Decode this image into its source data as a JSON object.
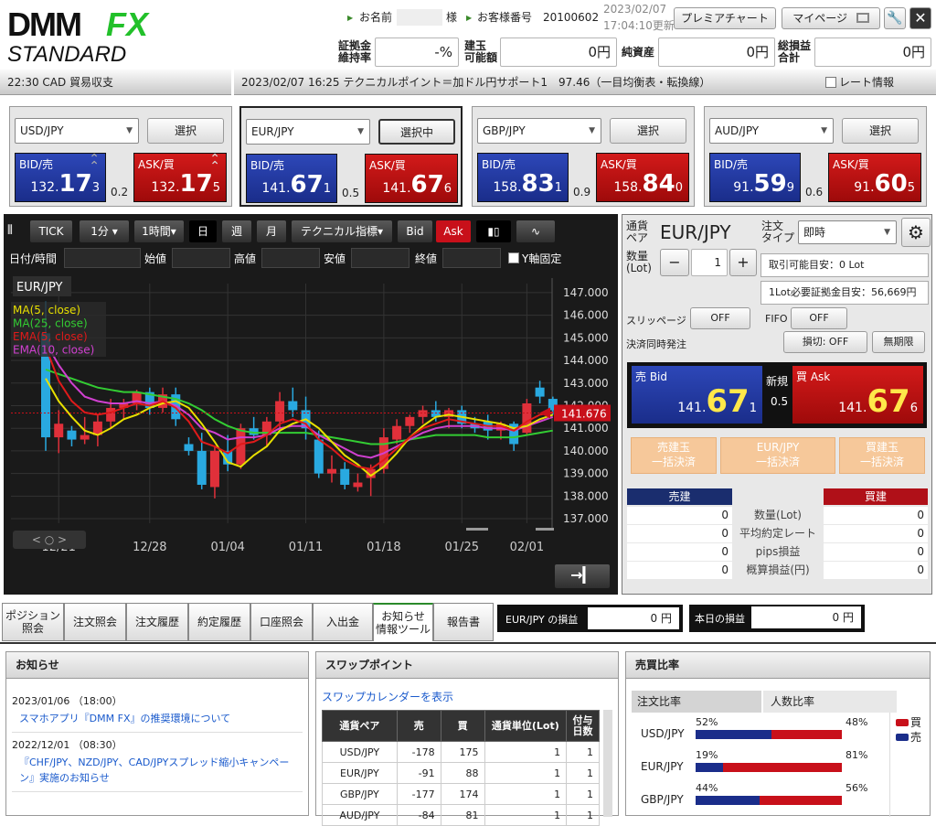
{
  "header": {
    "logo_top": "DMM",
    "logo_fx": "FX",
    "logo_bottom": "STANDARD",
    "name_label": "お名前",
    "name_suffix": "様",
    "customer_no_label": "お客様番号",
    "customer_no": "20100602",
    "date": "2023/02/07",
    "time": "17:04:10更新",
    "premier_chart": "プレミアチャート",
    "mypage": "マイページ",
    "margin_rate_label": "証拠金 維持率",
    "margin_rate": "-%",
    "open_pos_label": "建玉 可能額",
    "open_pos": "0円",
    "net_assets_label": "純資産",
    "net_assets": "0円",
    "total_pl_label": "総損益 合計",
    "total_pl": "0円"
  },
  "ticker": {
    "left": "22:30 CAD 貿易収支",
    "main": "2023/02/07 16:25 テクニカルポイント＝加ドル円サポート1　97.46（一目均衡表・転換線）",
    "rate_info": "レート情報"
  },
  "pairs": [
    {
      "pair": "USD/JPY",
      "button": "選択",
      "bid_small": "132.",
      "bid_big": "17",
      "bid_last": "3",
      "ask_small": "132.",
      "ask_big": "17",
      "ask_last": "5",
      "spread": "0.2",
      "selected": false
    },
    {
      "pair": "EUR/JPY",
      "button": "選択中",
      "bid_small": "141.",
      "bid_big": "67",
      "bid_last": "1",
      "ask_small": "141.",
      "ask_big": "67",
      "ask_last": "6",
      "spread": "0.5",
      "selected": true
    },
    {
      "pair": "GBP/JPY",
      "button": "選択",
      "bid_small": "158.",
      "bid_big": "83",
      "bid_last": "1",
      "ask_small": "158.",
      "ask_big": "84",
      "ask_last": "0",
      "spread": "0.9",
      "selected": false
    },
    {
      "pair": "AUD/JPY",
      "button": "選択",
      "bid_small": "91.",
      "bid_big": "59",
      "bid_last": "9",
      "ask_small": "91.",
      "ask_big": "60",
      "ask_last": "5",
      "spread": "0.6",
      "selected": false
    }
  ],
  "price_labels": {
    "bid": "BID/売",
    "ask": "ASK/買"
  },
  "toolbar": {
    "tick": "TICK",
    "min": "1分",
    "hour": "1時間",
    "day": "日",
    "week": "週",
    "month": "月",
    "technical": "テクニカル指標",
    "bid": "Bid",
    "ask": "Ask"
  },
  "ohlc": {
    "datetime": "日付/時間",
    "open": "始値",
    "high": "高値",
    "low": "安値",
    "close": "終値",
    "yfix": "Y軸固定"
  },
  "chart_data": {
    "type": "candlestick",
    "title": "EUR/JPY",
    "legend": [
      {
        "name": "MA(5, close)",
        "color": "#e8e000"
      },
      {
        "name": "MA(25, close)",
        "color": "#33cc33"
      },
      {
        "name": "EMA(5, close)",
        "color": "#e01a1a"
      },
      {
        "name": "EMA(10, close)",
        "color": "#d040d0"
      }
    ],
    "yticks": [
      "147.000",
      "146.000",
      "145.000",
      "144.000",
      "143.000",
      "142.000",
      "141.000",
      "140.000",
      "139.000",
      "138.000",
      "137.000"
    ],
    "ylim": [
      136.8,
      147.4
    ],
    "xticks": [
      "12/21",
      "12/28",
      "01/04",
      "01/11",
      "01/18",
      "01/25",
      "02/01"
    ],
    "current_price": "141.676",
    "current_value": 141.676,
    "candles": [
      {
        "o": 145.2,
        "h": 146.6,
        "l": 140.0,
        "c": 140.6
      },
      {
        "o": 140.6,
        "h": 141.8,
        "l": 139.9,
        "c": 141.2
      },
      {
        "o": 140.9,
        "h": 141.1,
        "l": 140.2,
        "c": 140.5
      },
      {
        "o": 140.5,
        "h": 141.5,
        "l": 140.3,
        "c": 140.7
      },
      {
        "o": 140.7,
        "h": 141.6,
        "l": 140.2,
        "c": 141.3
      },
      {
        "o": 141.3,
        "h": 142.3,
        "l": 141.0,
        "c": 141.9
      },
      {
        "o": 141.9,
        "h": 142.3,
        "l": 141.4,
        "c": 142.1
      },
      {
        "o": 142.1,
        "h": 142.7,
        "l": 141.8,
        "c": 142.6
      },
      {
        "o": 142.6,
        "h": 142.8,
        "l": 141.6,
        "c": 141.9
      },
      {
        "o": 141.9,
        "h": 142.8,
        "l": 141.7,
        "c": 142.5
      },
      {
        "o": 142.5,
        "h": 142.8,
        "l": 141.1,
        "c": 141.4
      },
      {
        "o": 140.3,
        "h": 140.6,
        "l": 139.8,
        "c": 140.0
      },
      {
        "o": 140.0,
        "h": 140.8,
        "l": 138.3,
        "c": 138.5
      },
      {
        "o": 138.4,
        "h": 140.2,
        "l": 137.9,
        "c": 140.0
      },
      {
        "o": 140.0,
        "h": 140.7,
        "l": 139.1,
        "c": 139.4
      },
      {
        "o": 139.4,
        "h": 141.2,
        "l": 139.2,
        "c": 141.0
      },
      {
        "o": 141.0,
        "h": 141.5,
        "l": 140.5,
        "c": 140.7
      },
      {
        "o": 140.7,
        "h": 141.5,
        "l": 140.2,
        "c": 141.3
      },
      {
        "o": 141.3,
        "h": 142.6,
        "l": 141.0,
        "c": 142.2
      },
      {
        "o": 142.2,
        "h": 142.8,
        "l": 141.5,
        "c": 141.8
      },
      {
        "o": 141.8,
        "h": 142.4,
        "l": 140.5,
        "c": 141.0
      },
      {
        "o": 140.5,
        "h": 140.9,
        "l": 138.8,
        "c": 139.0
      },
      {
        "o": 139.0,
        "h": 139.8,
        "l": 138.6,
        "c": 139.2
      },
      {
        "o": 139.2,
        "h": 139.5,
        "l": 138.3,
        "c": 138.5
      },
      {
        "o": 138.4,
        "h": 139.0,
        "l": 138.2,
        "c": 138.6
      },
      {
        "o": 138.8,
        "h": 139.4,
        "l": 138.0,
        "c": 139.2
      },
      {
        "o": 139.2,
        "h": 141.0,
        "l": 139.0,
        "c": 140.6
      },
      {
        "o": 140.5,
        "h": 141.4,
        "l": 140.3,
        "c": 141.1
      },
      {
        "o": 141.1,
        "h": 141.6,
        "l": 140.8,
        "c": 141.5
      },
      {
        "o": 141.5,
        "h": 142.0,
        "l": 141.2,
        "c": 141.8
      },
      {
        "o": 141.8,
        "h": 142.2,
        "l": 141.3,
        "c": 141.5
      },
      {
        "o": 141.5,
        "h": 141.9,
        "l": 141.0,
        "c": 141.8
      },
      {
        "o": 141.8,
        "h": 142.0,
        "l": 141.0,
        "c": 141.2
      },
      {
        "o": 141.2,
        "h": 141.5,
        "l": 140.8,
        "c": 141.0
      },
      {
        "o": 141.3,
        "h": 141.6,
        "l": 140.5,
        "c": 140.9
      },
      {
        "o": 140.9,
        "h": 141.3,
        "l": 140.5,
        "c": 141.2
      },
      {
        "o": 141.2,
        "h": 141.3,
        "l": 140.0,
        "c": 140.3
      },
      {
        "o": 140.8,
        "h": 142.3,
        "l": 140.7,
        "c": 142.1
      },
      {
        "o": 142.8,
        "h": 143.1,
        "l": 142.1,
        "c": 142.4
      },
      {
        "o": 142.3,
        "h": 142.4,
        "l": 141.6,
        "c": 141.8
      }
    ],
    "ma5": [
      143.2,
      142.2,
      141.5,
      140.9,
      140.7,
      141.0,
      141.4,
      141.6,
      141.9,
      142.1,
      142.2,
      141.9,
      141.2,
      140.4,
      139.5,
      139.3,
      139.8,
      140.2,
      140.9,
      141.2,
      141.4,
      141.0,
      140.4,
      139.8,
      139.4,
      138.9,
      139.3,
      139.9,
      140.6,
      141.1,
      141.5,
      141.6,
      141.5,
      141.4,
      141.3,
      141.2,
      141.0,
      141.1,
      141.4,
      141.6
    ],
    "ma25": [
      143.6,
      143.4,
      143.2,
      143.0,
      142.8,
      142.7,
      142.6,
      142.6,
      142.5,
      142.4,
      142.3,
      142.1,
      141.8,
      141.4,
      141.1,
      140.9,
      140.8,
      140.8,
      140.8,
      140.8,
      140.8,
      140.7,
      140.6,
      140.5,
      140.4,
      140.3,
      140.3,
      140.4,
      140.5,
      140.6,
      140.7,
      140.7,
      140.7,
      140.7,
      140.6,
      140.6,
      140.6,
      140.7,
      140.8,
      140.9
    ],
    "ema5": [
      144.6,
      143.1,
      142.2,
      141.7,
      141.6,
      141.7,
      141.9,
      142.1,
      142.0,
      142.2,
      141.9,
      141.3,
      140.4,
      140.2,
      139.9,
      140.3,
      140.4,
      140.7,
      141.2,
      141.4,
      141.2,
      140.5,
      140.1,
      139.6,
      139.3,
      139.2,
      139.6,
      140.1,
      140.6,
      141.0,
      141.2,
      141.4,
      141.3,
      141.2,
      141.1,
      141.1,
      140.9,
      141.3,
      141.6,
      141.7
    ],
    "ema10": [
      144.8,
      143.8,
      143.0,
      142.4,
      142.2,
      142.1,
      142.1,
      142.2,
      142.1,
      142.2,
      142.0,
      141.6,
      141.0,
      140.8,
      140.5,
      140.6,
      140.6,
      140.7,
      141.0,
      141.1,
      141.1,
      140.7,
      140.4,
      140.1,
      139.8,
      139.7,
      139.9,
      140.2,
      140.5,
      140.8,
      141.0,
      141.1,
      141.1,
      141.1,
      141.0,
      141.0,
      140.9,
      141.1,
      141.3,
      141.5
    ]
  },
  "order": {
    "pair_label": "通貨 ペア",
    "pair": "EUR/JPY",
    "type_label": "注文 タイプ",
    "type": "即時",
    "qty_label": "数量 (Lot)",
    "qty": "1",
    "available": "取引可能目安：0 Lot",
    "margin_needed": "1Lot必要証拠金目安：56,669円",
    "slippage_label": "スリッページ",
    "slippage": "OFF",
    "fifo_label": "FIFO",
    "fifo": "OFF",
    "settle_label": "決済同時発注",
    "settle1": "損切: OFF",
    "settle2": "無期限",
    "bid_label": "売 Bid",
    "bid_small": "141.",
    "bid_big": "67",
    "bid_last": "1",
    "new_label": "新規",
    "spread": "0.5",
    "ask_label": "買 Ask",
    "ask_small": "141.",
    "ask_big": "67",
    "ask_last": "6",
    "bulk_sell": "売建玉 一括決済",
    "bulk_pair": "EUR/JPY 一括決済",
    "bulk_buy": "買建玉 一括決済",
    "sell_head": "売建",
    "buy_head": "買建",
    "rows": [
      {
        "label": "数量(Lot)",
        "sell": "0",
        "buy": "0"
      },
      {
        "label": "平均約定レート",
        "sell": "0",
        "buy": "0"
      },
      {
        "label": "pips損益",
        "sell": "0",
        "buy": "0"
      },
      {
        "label": "概算損益(円)",
        "sell": "0",
        "buy": "0"
      }
    ]
  },
  "tabs": [
    "ポジション 照会",
    "注文照会",
    "注文履歴",
    "約定履歴",
    "口座照会",
    "入出金",
    "お知らせ 情報ツール",
    "報告書"
  ],
  "pl": {
    "pair_label": "EUR/JPY の損益",
    "pair_value": "0 円",
    "today_label": "本日の損益",
    "today_value": "0 円"
  },
  "news": {
    "title": "お知らせ",
    "items": [
      {
        "date": "2023/01/06 （18:00）",
        "text": "スマホアプリ『DMM FX』の推奨環境について"
      },
      {
        "date": "2022/12/01 （08:30）",
        "text": "『CHF/JPY、NZD/JPY、CAD/JPYスプレッド縮小キャンペーン』実施のお知らせ"
      }
    ]
  },
  "swap": {
    "title": "スワップポイント",
    "link": "スワップカレンダーを表示",
    "headers": [
      "通貨ペア",
      "売",
      "買",
      "通貨単位(Lot)",
      "付与 日数"
    ],
    "rows": [
      [
        "USD/JPY",
        "-178",
        "175",
        "1",
        "1"
      ],
      [
        "EUR/JPY",
        "-91",
        "88",
        "1",
        "1"
      ],
      [
        "GBP/JPY",
        "-177",
        "174",
        "1",
        "1"
      ],
      [
        "AUD/JPY",
        "-84",
        "81",
        "1",
        "1"
      ]
    ]
  },
  "ratio": {
    "title": "売買比率",
    "tab1": "注文比率",
    "tab2": "人数比率",
    "legend_buy": "買",
    "legend_sell": "売",
    "rows": [
      {
        "pair": "USD/JPY",
        "sell": "52%",
        "buy": "48%",
        "sell_frac": 0.52
      },
      {
        "pair": "EUR/JPY",
        "sell": "19%",
        "buy": "81%",
        "sell_frac": 0.19
      },
      {
        "pair": "GBP/JPY",
        "sell": "44%",
        "buy": "56%",
        "sell_frac": 0.44
      }
    ]
  },
  "colors": {
    "bid": "#1a2d8a",
    "ask": "#b01010",
    "up": "#e0303a",
    "down": "#29a9e0",
    "price_digits": "#ffe84a"
  }
}
